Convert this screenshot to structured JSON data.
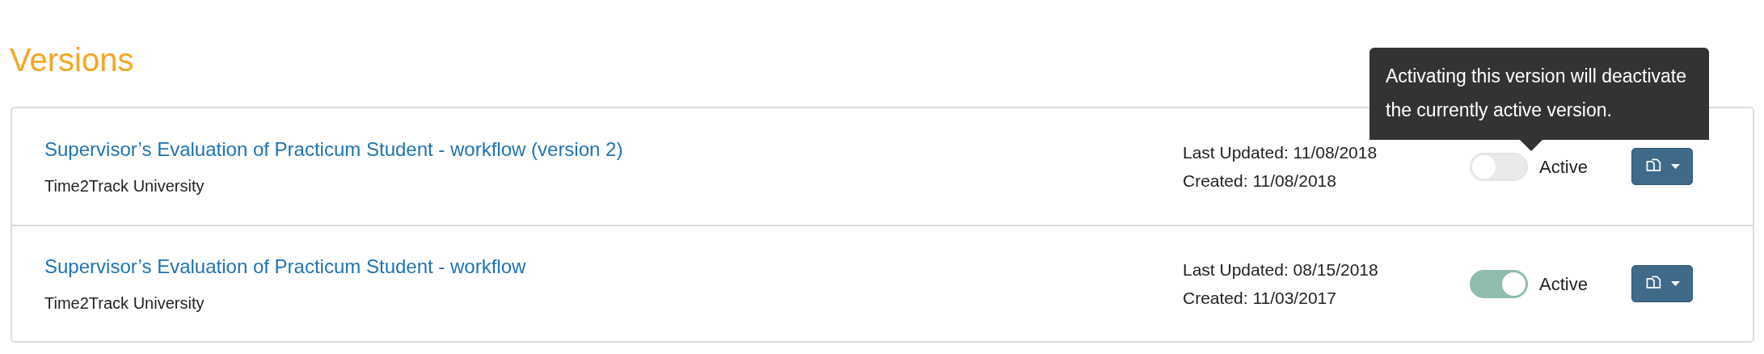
{
  "heading": "Versions",
  "tooltip": {
    "text": "Activating this version will deactivate the currently active version."
  },
  "versions": [
    {
      "title": "Supervisor’s Evaluation of Practicum Student - workflow (version 2)",
      "organization": "Time2Track University",
      "last_updated": "Last Updated: 11/08/2018",
      "created": "Created: 11/08/2018",
      "active": false,
      "active_label": "Active"
    },
    {
      "title": "Supervisor’s Evaluation of Practicum Student - workflow",
      "organization": "Time2Track University",
      "last_updated": "Last Updated: 08/15/2018",
      "created": "Created: 11/03/2017",
      "active": true,
      "active_label": "Active"
    }
  ]
}
